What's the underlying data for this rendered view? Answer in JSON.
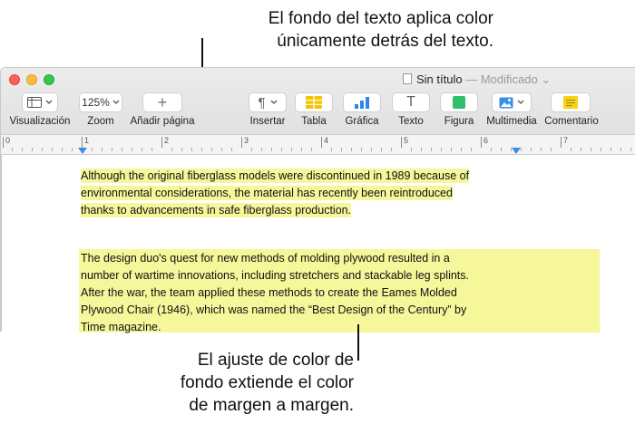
{
  "callouts": {
    "top": [
      "El fondo del texto aplica color",
      "únicamente detrás del texto."
    ],
    "bottom": [
      "El ajuste de color de",
      "fondo extiende el color",
      "de margen a margen."
    ]
  },
  "window": {
    "title": "Sin título",
    "title_suffix": "— Modificado",
    "title_chevron": "⌄"
  },
  "toolbar": {
    "view": {
      "label": "Visualización",
      "icon": "sidebar-icon"
    },
    "zoom": {
      "label": "Zoom",
      "value": "125%"
    },
    "add_page": {
      "label": "Añadir página",
      "glyph": "+"
    },
    "insert": {
      "label": "Insertar",
      "glyph": "¶"
    },
    "table": {
      "label": "Tabla",
      "color": "#f5c400"
    },
    "chart": {
      "label": "Gráfica",
      "color": "#2f86e8"
    },
    "text": {
      "label": "Texto",
      "glyph": "T"
    },
    "shape": {
      "label": "Figura",
      "color": "#2fc06b"
    },
    "media": {
      "label": "Multimedia",
      "color": "#3a8ee6"
    },
    "comment": {
      "label": "Comentario",
      "color": "#f7d21b"
    }
  },
  "ruler": {
    "numbers": [
      "0",
      "1",
      "2",
      "3",
      "4",
      "5",
      "6",
      "7"
    ],
    "marker_color": "#3a8ee6"
  },
  "document": {
    "highlight_color": "#f6f69a",
    "para1_lines": [
      "Although the original fiberglass models were discontinued in 1989 because of",
      "environmental considerations, the material has recently been reintroduced",
      "thanks to advancements in safe fiberglass production."
    ],
    "para2_lines": [
      "The design duo's quest for new methods of molding plywood resulted in a",
      "number of wartime innovations, including stretchers and stackable leg splints.",
      "After the war, the team applied these methods to create the Eames Molded",
      "Plywood Chair (1946), which was named the “Best Design of the Century” by",
      "Time magazine."
    ]
  }
}
